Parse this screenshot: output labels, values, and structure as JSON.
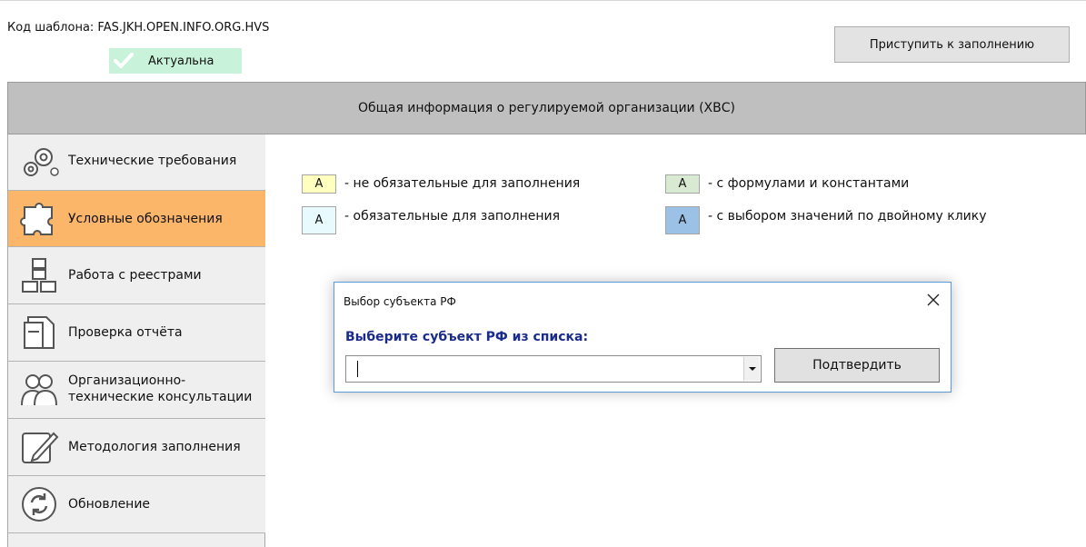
{
  "top": {
    "template_code": "Код шаблона: FAS.JKH.OPEN.INFO.ORG.HVS",
    "status": "Актуальна",
    "start_button": "Приступить к заполнению"
  },
  "header": {
    "title": "Общая информация о регулируемой организации (ХВС)"
  },
  "sidebar": {
    "items": [
      {
        "label": "Технические требования",
        "icon": "gears-icon"
      },
      {
        "label": "Условные обозначения",
        "icon": "puzzle-icon"
      },
      {
        "label": "Работа с реестрами",
        "icon": "registry-icon"
      },
      {
        "label": "Проверка отчёта",
        "icon": "document-check-icon"
      },
      {
        "label": "Организационно-",
        "label2": "технические консультации",
        "icon": "people-icon"
      },
      {
        "label": "Методология заполнения",
        "icon": "pencil-icon"
      },
      {
        "label": "Обновление",
        "icon": "refresh-icon"
      }
    ]
  },
  "legend": {
    "items": [
      {
        "cell": "A",
        "text": "- не обязательные для заполнения",
        "color": "#ffffc0"
      },
      {
        "cell": "A",
        "text": "- обязательные для заполнения",
        "color": "#e8fafe"
      },
      {
        "cell": "A",
        "text": "- с формулами и константами",
        "color": "#d8ead2"
      },
      {
        "cell": "A",
        "text": "- с выбором значений по двойному клику",
        "color": "#9bc2e6"
      }
    ]
  },
  "dialog": {
    "title": "Выбор субъекта РФ",
    "prompt": "Выберите субъект РФ из списка:",
    "combo_value": "",
    "confirm_button": "Подтвердить"
  },
  "colors": {
    "status_bg": "#c8f2da",
    "active_item": "#fbb66a",
    "header_bg": "#bfbfbf",
    "prompt_text": "#1a2b8c"
  }
}
